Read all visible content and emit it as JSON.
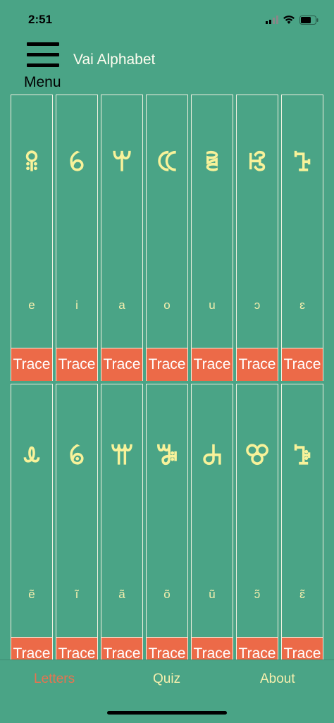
{
  "status": {
    "time": "2:51"
  },
  "header": {
    "menu_label": "Menu",
    "title": "Vai Alphabet"
  },
  "letters_row1": [
    {
      "glyph": "ꕉ",
      "roman": "e",
      "button": "Trace"
    },
    {
      "glyph": "ꕃ",
      "roman": "i",
      "button": "Trace"
    },
    {
      "glyph": "ꕚ",
      "roman": "a",
      "button": "Trace"
    },
    {
      "glyph": "ꕆ",
      "roman": "o",
      "button": "Trace"
    },
    {
      "glyph": "ꕇ",
      "roman": "u",
      "button": "Trace"
    },
    {
      "glyph": "ꕙ",
      "roman": "ɔ",
      "button": "Trace"
    },
    {
      "glyph": "ꕱ",
      "roman": "ɛ",
      "button": "Trace"
    }
  ],
  "letters_row2": [
    {
      "glyph": "ꕊ",
      "roman": "ẽ",
      "button": "Trace"
    },
    {
      "glyph": "ꕄ",
      "roman": "ĩ",
      "button": "Trace"
    },
    {
      "glyph": "ꕌ",
      "roman": "ã",
      "button": "Trace"
    },
    {
      "glyph": "ꕅ",
      "roman": "õ",
      "button": "Trace"
    },
    {
      "glyph": "ꕈ",
      "roman": "ũ",
      "button": "Trace"
    },
    {
      "glyph": "ꕢ",
      "roman": "ɔ̃",
      "button": "Trace"
    },
    {
      "glyph": "ꕲ",
      "roman": "ɛ̃",
      "button": "Trace"
    }
  ],
  "tabs": [
    {
      "label": "Letters",
      "active": true
    },
    {
      "label": "Quiz",
      "active": false
    },
    {
      "label": "About",
      "active": false
    }
  ],
  "colors": {
    "background": "#4aa486",
    "glyph": "#f8f29a",
    "trace_button": "#ec6a48",
    "active_tab": "#e8734f",
    "inactive_tab": "#f6efae"
  }
}
